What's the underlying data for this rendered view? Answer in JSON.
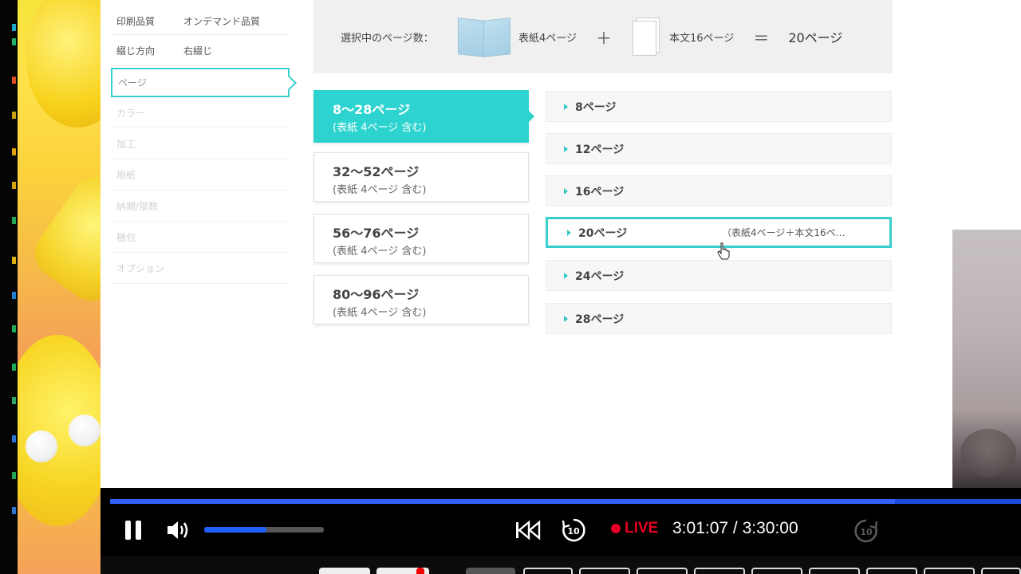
{
  "menu": {
    "rows": [
      {
        "label": "印刷品質",
        "value": "オンデマンド品質"
      },
      {
        "label": "綴じ方向",
        "value": "右綴じ"
      },
      {
        "label": "ページ",
        "value": ""
      },
      {
        "label": "カラー",
        "value": ""
      },
      {
        "label": "加工",
        "value": ""
      },
      {
        "label": "用紙",
        "value": ""
      },
      {
        "label": "納期/部数",
        "value": ""
      },
      {
        "label": "梱包",
        "value": ""
      },
      {
        "label": "オプション",
        "value": ""
      }
    ]
  },
  "summary": {
    "label": "選択中のページ数：",
    "cover": "表紙4ページ",
    "plus": "＋",
    "body": "本文16ページ",
    "equals": "＝",
    "total": "20ページ"
  },
  "groups": [
    {
      "title": "8〜28ページ",
      "sub": "(表紙 4ページ 含む)"
    },
    {
      "title": "32〜52ページ",
      "sub": "(表紙 4ページ 含む)"
    },
    {
      "title": "56〜76ページ",
      "sub": "(表紙 4ページ 含む)"
    },
    {
      "title": "80〜96ページ",
      "sub": "(表紙 4ページ 含む)"
    }
  ],
  "options": [
    {
      "label": "8ページ",
      "note": ""
    },
    {
      "label": "12ページ",
      "note": ""
    },
    {
      "label": "16ページ",
      "note": ""
    },
    {
      "label": "20ページ",
      "note": "（表紙4ページ＋本文16ペ…"
    },
    {
      "label": "24ページ",
      "note": ""
    },
    {
      "label": "28ページ",
      "note": ""
    }
  ],
  "player": {
    "live_label": "LIVE",
    "time": "3:01:07 / 3:30:00",
    "progress_fraction": 0.862,
    "volume_fraction": 0.52,
    "colors": {
      "progress": "#2f62ff",
      "live": "#e60023",
      "accent": "#2dd3cf"
    }
  }
}
